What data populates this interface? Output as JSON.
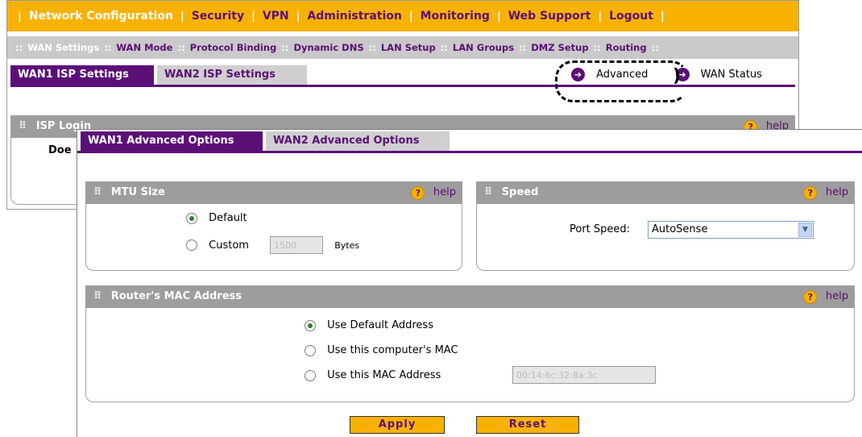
{
  "top_nav": {
    "items": [
      {
        "label": "Network Configuration",
        "active": true
      },
      {
        "label": "Security",
        "active": false
      },
      {
        "label": "VPN",
        "active": false
      },
      {
        "label": "Administration",
        "active": false
      },
      {
        "label": "Monitoring",
        "active": false
      },
      {
        "label": "Web Support",
        "active": false
      },
      {
        "label": "Logout",
        "active": false
      }
    ]
  },
  "sub_nav": {
    "items": [
      {
        "label": "WAN Settings",
        "active": true
      },
      {
        "label": "WAN Mode",
        "active": false
      },
      {
        "label": "Protocol Binding",
        "active": false
      },
      {
        "label": "Dynamic DNS",
        "active": false
      },
      {
        "label": "LAN Setup",
        "active": false
      },
      {
        "label": "LAN Groups",
        "active": false
      },
      {
        "label": "DMZ Setup",
        "active": false
      },
      {
        "label": "Routing",
        "active": false
      }
    ]
  },
  "bg_tabs": {
    "wan1": "WAN1 ISP Settings",
    "wan2": "WAN2 ISP Settings"
  },
  "bg_links": {
    "advanced": "Advanced",
    "wan_status": "WAN Status"
  },
  "isp_login": {
    "title": "ISP Login",
    "help": "help",
    "partial_text": "Doe"
  },
  "popup_tabs": {
    "wan1": "WAN1 Advanced Options",
    "wan2": "WAN2 Advanced Options"
  },
  "mtu": {
    "title": "MTU Size",
    "help": "help",
    "default_label": "Default",
    "custom_label": "Custom",
    "custom_value": "1500",
    "unit": "Bytes",
    "selected": "default"
  },
  "speed": {
    "title": "Speed",
    "help": "help",
    "port_label": "Port Speed:",
    "port_value": "AutoSense"
  },
  "mac": {
    "title": "Router's MAC Address",
    "help": "help",
    "opt_default": "Use Default Address",
    "opt_computer": "Use this computer's MAC",
    "opt_custom": "Use this MAC Address",
    "custom_value": "00:14:6c:32:8a:3c",
    "selected": "default"
  },
  "buttons": {
    "apply": "Apply",
    "reset": "Reset"
  },
  "colors": {
    "accent_orange": "#f7b200",
    "purple": "#5b1077",
    "section_gray": "#9d9d9d"
  }
}
